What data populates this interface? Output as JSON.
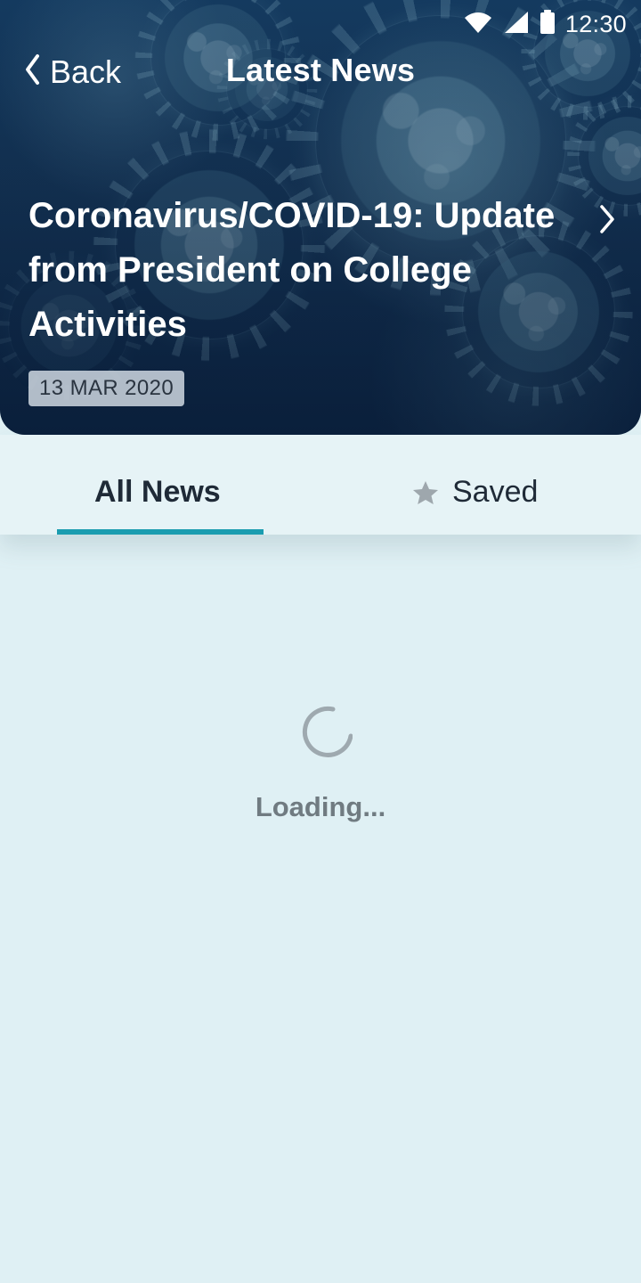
{
  "status_bar": {
    "time": "12:30"
  },
  "header": {
    "back_label": "Back",
    "title": "Latest News"
  },
  "featured_story": {
    "title": "Coronavirus/COVID-19: Update from President on College Activities",
    "date": "13 MAR 2020"
  },
  "tabs": [
    {
      "label": "All News"
    },
    {
      "label": "Saved"
    }
  ],
  "content": {
    "loading_text": "Loading..."
  },
  "colors": {
    "accent": "#1a9cb0",
    "background": "#dff0f4",
    "hero_dark": "#0d2747",
    "muted_text": "#707b81"
  },
  "icons": {
    "status": [
      "wifi-icon",
      "signal-icon",
      "battery-icon"
    ],
    "navigation": [
      "chevron-left-icon",
      "chevron-right-icon",
      "star-icon",
      "loading-spinner-icon"
    ]
  }
}
